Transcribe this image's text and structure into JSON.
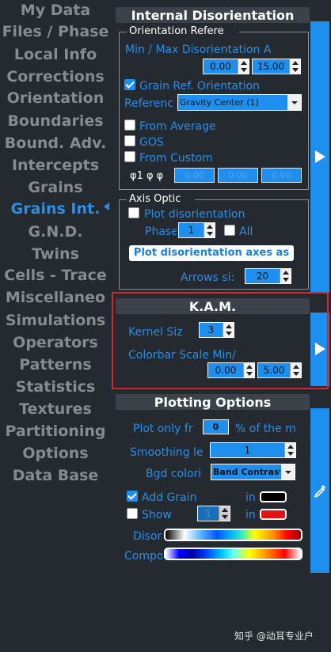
{
  "nav": {
    "items": [
      {
        "label": "My Data"
      },
      {
        "label": "Files / Phase"
      },
      {
        "label": "Local Info"
      },
      {
        "label": "Corrections"
      },
      {
        "label": "Orientation"
      },
      {
        "label": "Boundaries"
      },
      {
        "label": "Bound. Adv."
      },
      {
        "label": "Intercepts"
      },
      {
        "label": "Grains"
      },
      {
        "label": "Grains Int."
      },
      {
        "label": "G.N.D."
      },
      {
        "label": "Twins"
      },
      {
        "label": "Cells - Trace"
      },
      {
        "label": "Miscellaneo"
      },
      {
        "label": "Simulations"
      },
      {
        "label": "Operators"
      },
      {
        "label": "Patterns"
      },
      {
        "label": "Statistics"
      },
      {
        "label": "Textures"
      },
      {
        "label": "Partitioning"
      },
      {
        "label": "Options"
      },
      {
        "label": "Data Base"
      }
    ],
    "active_item": "Grains Int.",
    "active_color": "#2a8ee8"
  },
  "internal": {
    "title": "Internal Disorientation",
    "orientation_group": {
      "legend": "Orientation Refere",
      "min_max_label": "Min / Max Disorientation A",
      "min_value": "0.00",
      "max_value": "15.00",
      "grain_ref_label": "Grain Ref. Orientation",
      "grain_ref_checked": true,
      "reference_label": "Referenc",
      "reference_value": "Gravity Center (1)",
      "from_average_label": "From Average",
      "gos_label": "GOS",
      "from_custom_label": "From Custom",
      "euler_label": "φ1  φ  φ",
      "euler_values": [
        "0.00",
        "0.00",
        "0.00"
      ]
    },
    "axis_group": {
      "legend": "Axis Optic",
      "plot_label": "Plot disorientation",
      "phase_label": "Phase",
      "phase_value": "1",
      "all_label": "All",
      "axes_button": "Plot disorientation axes as",
      "arrows_label": "Arrows si:",
      "arrows_value": "20"
    }
  },
  "kam": {
    "title": "K.A.M.",
    "kernel_label": "Kernel Siz",
    "kernel_value": "3",
    "colorbar_label": "Colorbar Scale Min/",
    "min_value": "0.00",
    "max_value": "5.00",
    "highlight_color": "#d4262b"
  },
  "plotting": {
    "title": "Plotting Options",
    "plot_only_label": "Plot only fr",
    "plot_only_value": "0",
    "plot_only_suffix": "% of the m",
    "smoothing_label": "Smoothing le",
    "smoothing_value": "1",
    "bgd_label": "Bgd colori",
    "bgd_value": "Band Contrast",
    "add_grain_label": "Add Grain",
    "add_grain_checked": true,
    "in_label": "in",
    "add_grain_color": "#000000",
    "show_label": "Show",
    "show_value": "1",
    "show_color": "#e01515",
    "disor_label": "Disor",
    "compo_label": "Compo"
  },
  "watermark": "知乎 @动耳专业户",
  "colors": {
    "accent": "#1e8fee",
    "background": "#252a30",
    "header": "#3c4249"
  }
}
